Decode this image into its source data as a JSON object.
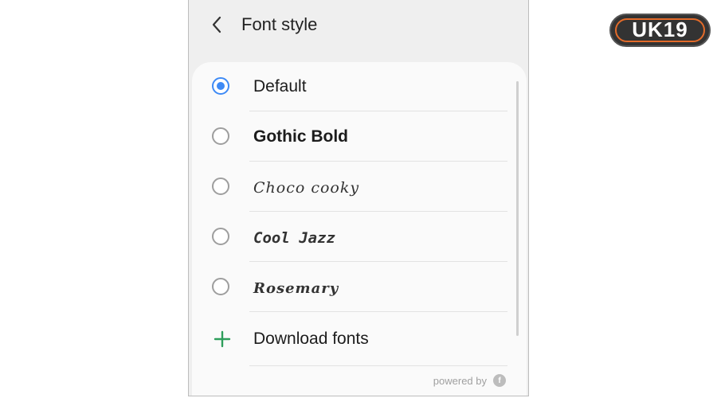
{
  "header": {
    "back_icon": "chevron-left-icon",
    "title": "Font style"
  },
  "fonts": [
    {
      "label": "Default",
      "selected": true
    },
    {
      "label": "Gothic Bold",
      "selected": false
    },
    {
      "label": "Choco cooky",
      "selected": false
    },
    {
      "label": "Cool Jazz",
      "selected": false
    },
    {
      "label": "Rosemary",
      "selected": false
    }
  ],
  "download": {
    "icon": "plus-icon",
    "label": "Download fonts",
    "icon_color": "#2e9e5b"
  },
  "footer": {
    "powered_text": "powered by"
  },
  "watermark": {
    "text": "UK19"
  },
  "colors": {
    "accent": "#3e8af5",
    "background": "#efefef",
    "card": "#fafafa"
  }
}
